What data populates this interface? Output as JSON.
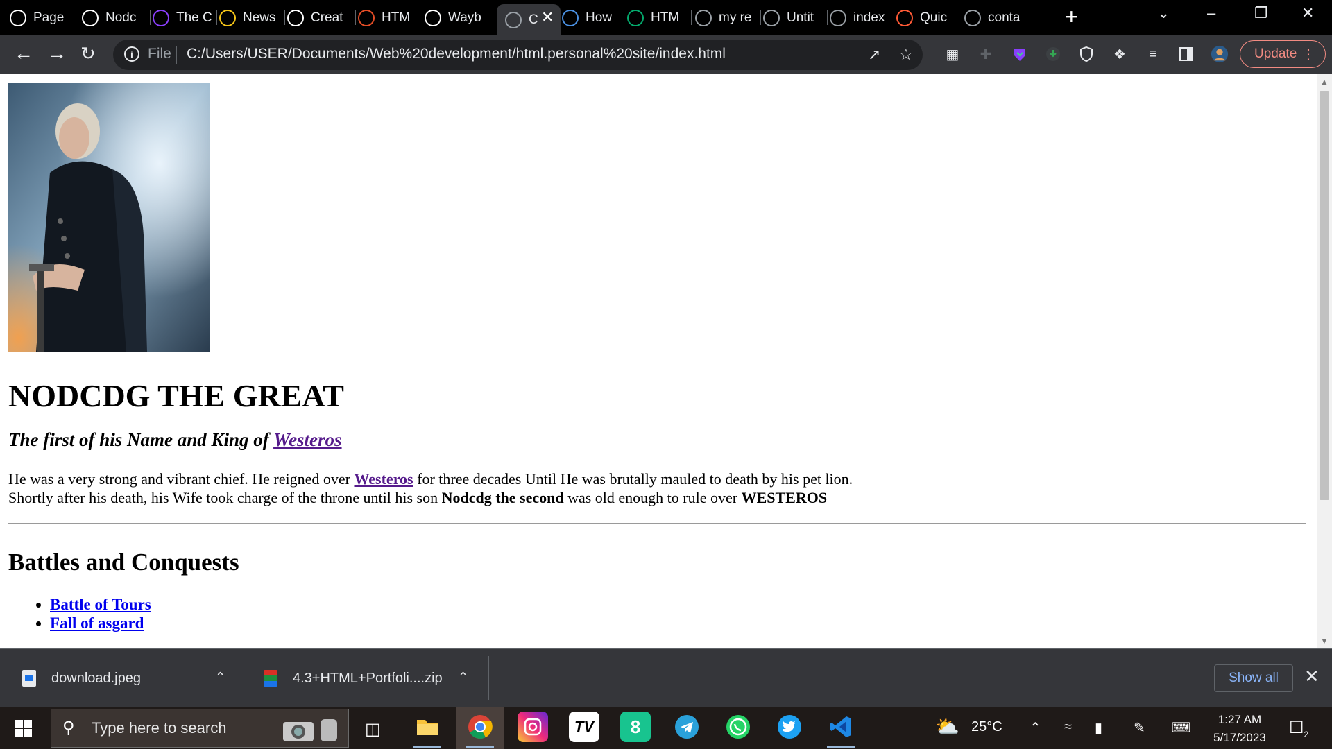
{
  "tabs": [
    {
      "label": "Page",
      "icon": "github-icon",
      "color": "#ffffff"
    },
    {
      "label": "Nodc",
      "icon": "github-icon",
      "color": "#ffffff"
    },
    {
      "label": "The C",
      "icon": "brave-talk-icon",
      "color": "#8a3ffc"
    },
    {
      "label": "News",
      "icon": "newsletter-icon",
      "color": "#f5c518"
    },
    {
      "label": "Creat",
      "icon": "codepen-icon",
      "color": "#ffffff"
    },
    {
      "label": "HTM",
      "icon": "html-tutorial-icon",
      "color": "#e44d26"
    },
    {
      "label": "Wayb",
      "icon": "wayback-machine-icon",
      "color": "#ffffff"
    },
    {
      "label": "C",
      "icon": "globe-icon",
      "color": "#9aa0a6",
      "active": true
    },
    {
      "label": "How",
      "icon": "stack-icon",
      "color": "#4a90e2"
    },
    {
      "label": "HTM",
      "icon": "w3schools-icon",
      "color": "#04aa6d"
    },
    {
      "label": "my re",
      "icon": "globe-icon",
      "color": "#9aa0a6"
    },
    {
      "label": "Untit",
      "icon": "globe-icon",
      "color": "#9aa0a6"
    },
    {
      "label": "index",
      "icon": "globe-icon",
      "color": "#9aa0a6"
    },
    {
      "label": "Quic",
      "icon": "asterisk-icon",
      "color": "#ff5a36"
    },
    {
      "label": "conta",
      "icon": "globe-icon",
      "color": "#9aa0a6"
    }
  ],
  "toolbar": {
    "file_label": "File",
    "url": "C:/Users/USER/Documents/Web%20development/html.personal%20site/index.html",
    "update_label": "Update"
  },
  "page": {
    "title": "NODCDG THE GREAT",
    "subtitle_prefix": "The first of his Name and King of ",
    "subtitle_link": "Westeros",
    "bio_part1": "He was a very strong and vibrant chief. He reigned over ",
    "bio_link": "Westeros",
    "bio_part2": " for three decades Until He was brutally mauled to death by his pet lion.",
    "bio_part3": "Shortly after his death, his Wife took charge of the throne until his son ",
    "bio_bold1": "Nodcdg the second",
    "bio_part4": " was old enough to rule over ",
    "bio_bold2": "WESTEROS",
    "section_heading": "Battles and Conquests",
    "battles": [
      "Battle of Tours",
      "Fall of asgard"
    ]
  },
  "downloads": {
    "items": [
      {
        "name": "download.jpeg"
      },
      {
        "name": "4.3+HTML+Portfoli....zip"
      }
    ],
    "show_all": "Show all"
  },
  "taskbar": {
    "search_placeholder": "Type here to search",
    "weather": "25°C",
    "time": "1:27 AM",
    "date": "5/17/2023",
    "notification_count": "2"
  }
}
